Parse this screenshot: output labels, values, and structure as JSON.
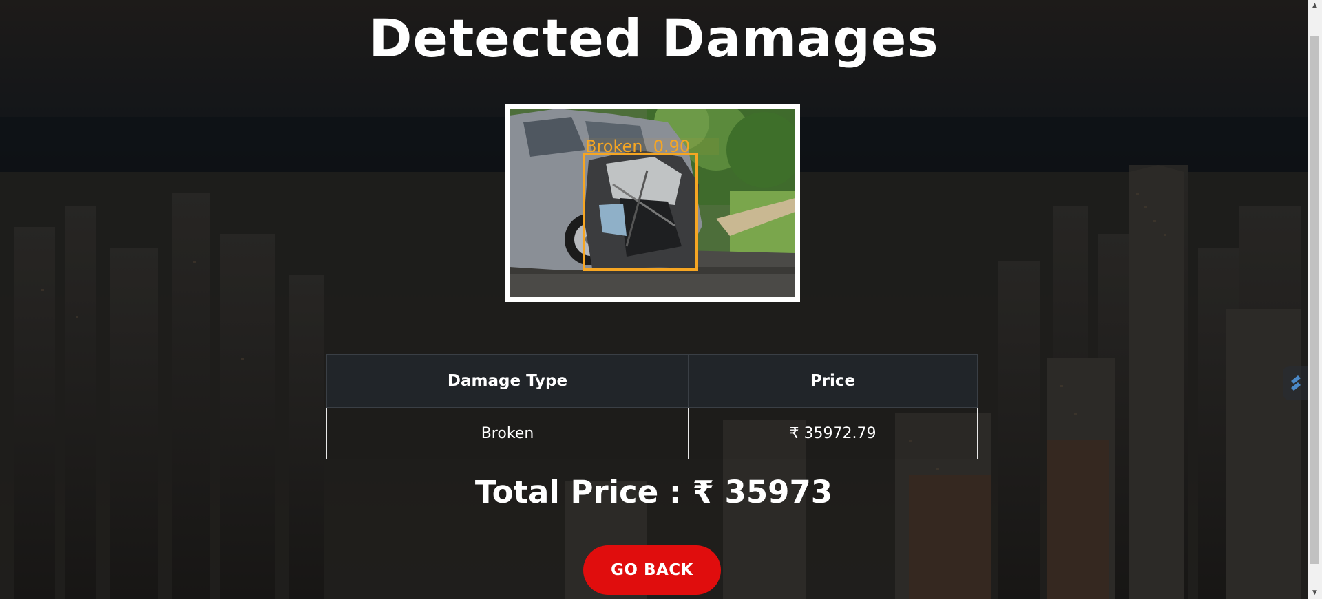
{
  "page": {
    "title": "Detected Damages"
  },
  "result_image": {
    "detection_label": "Broken  0.90"
  },
  "table": {
    "headers": {
      "damage_type": "Damage Type",
      "price": "Price"
    },
    "rows": [
      {
        "damage_type": "Broken",
        "price": "₹ 35972.79"
      }
    ]
  },
  "total_price": "Total Price : ₹ 35973",
  "go_back_label": "GO BACK",
  "colors": {
    "button": "#e00d0d",
    "table_header": "#212529",
    "detection_box": "#f6a623"
  }
}
